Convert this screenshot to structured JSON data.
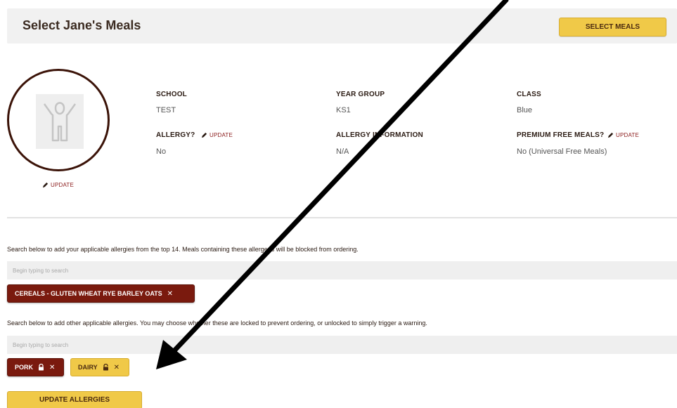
{
  "header": {
    "title": "Select Jane's Meals",
    "select_meals_label": "SELECT MEALS"
  },
  "profile": {
    "avatar_update_label": "UPDATE",
    "school_label": "SCHOOL",
    "school_value": "TEST",
    "year_group_label": "YEAR GROUP",
    "year_group_value": "KS1",
    "class_label": "CLASS",
    "class_value": "Blue",
    "allergy_label": "ALLERGY?",
    "allergy_update_label": "UPDATE",
    "allergy_value": "No",
    "allergy_info_label": "ALLERGY INFORMATION",
    "allergy_info_value": "N/A",
    "premium_label": "PREMIUM FREE MEALS?",
    "premium_update_label": "UPDATE",
    "premium_value": "No (Universal Free Meals)"
  },
  "top14": {
    "instruction": "Search below to add your applicable allergies from the top 14. Meals containing these allergens will be blocked from ordering.",
    "placeholder": "Begin typing to search",
    "tags": [
      {
        "label": "CEREALS - GLUTEN WHEAT RYE BARLEY OATS",
        "style": "red"
      }
    ]
  },
  "other": {
    "instruction": "Search below to add other applicable allergies. You may choose whether these are locked to prevent ordering, or unlocked to simply trigger a warning.",
    "placeholder": "Begin typing to search",
    "tags": [
      {
        "label": "PORK",
        "style": "red",
        "lock": "locked"
      },
      {
        "label": "DAIRY",
        "style": "yellow",
        "lock": "unlocked"
      }
    ]
  },
  "update_allergies_label": "UPDATE ALLERGIES",
  "colors": {
    "dark_red": "#7a1a0e",
    "gold": "#f0c948",
    "avatar_border": "#3b1308"
  }
}
